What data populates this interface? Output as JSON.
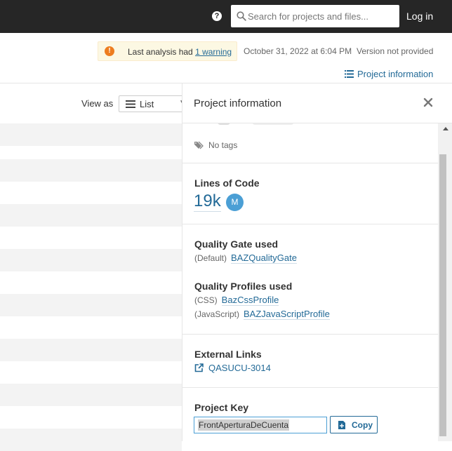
{
  "header": {
    "search": {
      "placeholder": "Search for projects and files..."
    },
    "login_label": "Log in",
    "help_icon": "question-circle-icon"
  },
  "analysis": {
    "warning_prefix": "Last analysis had ",
    "warning_link": "1 warning",
    "date": "October 31, 2022 at 6:04 PM",
    "version": "Version not provided",
    "project_info_link": "Project information"
  },
  "list_view": {
    "view_as_label": "View as",
    "view_selected": "List"
  },
  "panel": {
    "title": "Project information",
    "tags_label": "No tags",
    "lines_of_code": {
      "title": "Lines of Code",
      "value": "19k",
      "size_badge": "M"
    },
    "quality_gate": {
      "title": "Quality Gate used",
      "qualifier": "(Default)",
      "name": "BAZQualityGate"
    },
    "quality_profiles": {
      "title": "Quality Profiles used",
      "items": [
        {
          "language": "(CSS)",
          "name": "BazCssProfile"
        },
        {
          "language": "(JavaScript)",
          "name": "BAZJavaScriptProfile"
        }
      ]
    },
    "external_links": {
      "title": "External Links",
      "items": [
        {
          "label": "QASUCU-3014"
        }
      ]
    },
    "project_key": {
      "title": "Project Key",
      "value": "FrontAperturaDeCuenta",
      "copy_label": "Copy"
    }
  },
  "colors": {
    "topbar": "#262626",
    "link": "#236a97",
    "warning_bg": "#fcf8e3",
    "warning_icon": "#ed7d20",
    "badge": "#4b9fd5"
  }
}
